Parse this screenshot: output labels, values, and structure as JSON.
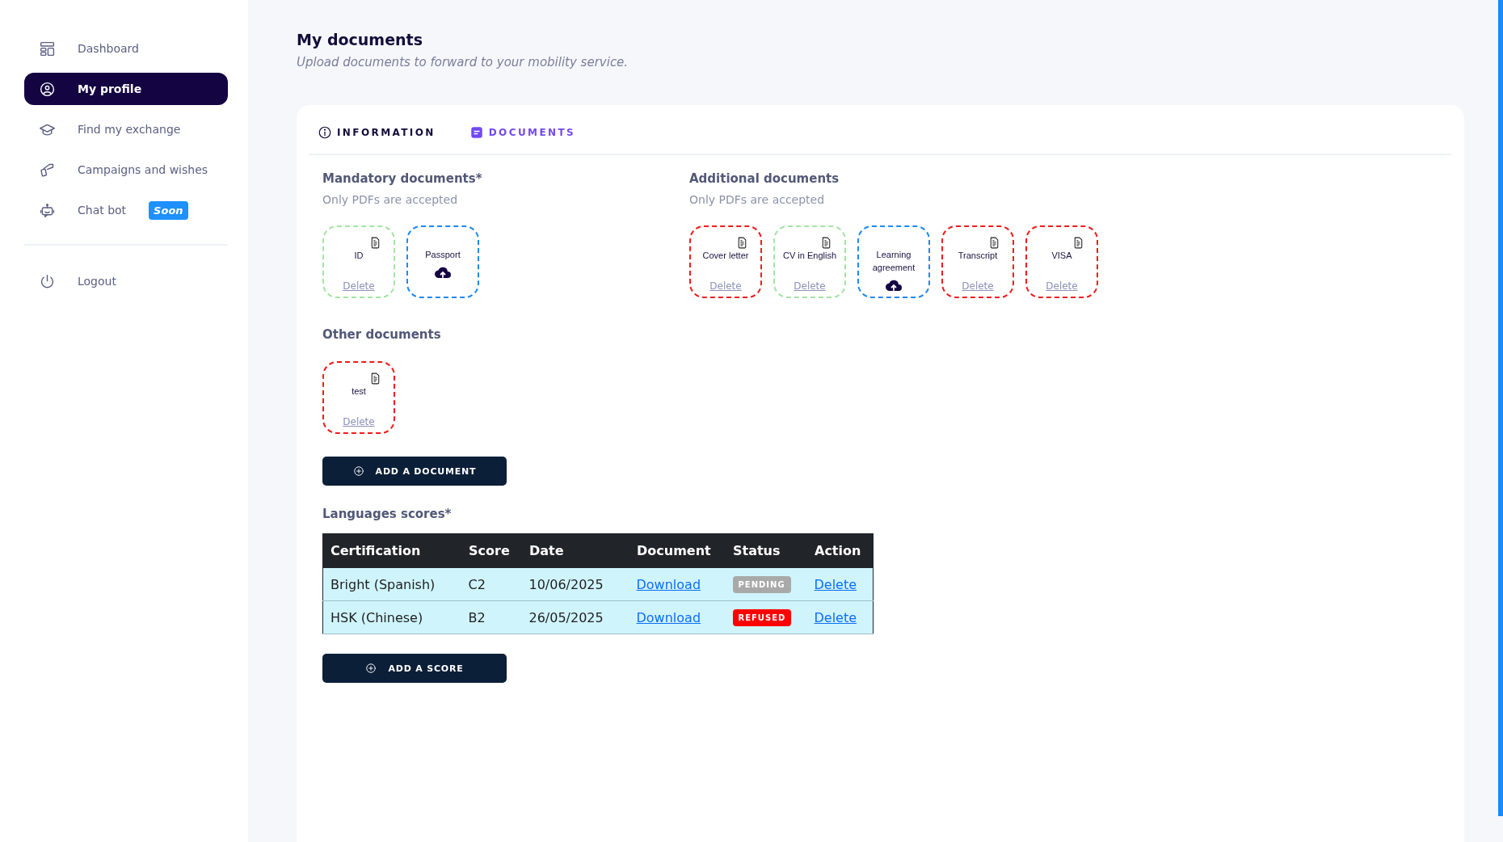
{
  "sidebar": {
    "items": [
      {
        "label": "Dashboard",
        "selected": false
      },
      {
        "label": "My profile",
        "selected": true
      },
      {
        "label": "Find my exchange",
        "selected": false
      },
      {
        "label": "Campaigns and wishes",
        "selected": false
      },
      {
        "label": "Chat bot",
        "selected": false,
        "badge": "Soon"
      }
    ],
    "footer_items": [
      {
        "label": "Logout",
        "selected": false
      }
    ]
  },
  "page": {
    "title": "My documents",
    "subtitle": "Upload documents to forward to your mobility service."
  },
  "tabs": [
    {
      "label": "INFORMATION",
      "selected": false
    },
    {
      "label": "DOCUMENTS",
      "selected": true
    }
  ],
  "groups": [
    {
      "title": "Mandatory documents*",
      "note": "Only PDFs are accepted",
      "documents": [
        {
          "name": "ID",
          "kind": "file",
          "color": "#a3e4a3",
          "action": "Delete"
        },
        {
          "name": "Passport",
          "kind": "upload",
          "color": "#1e88f5"
        }
      ]
    },
    {
      "title": "Additional documents",
      "note": "Only PDFs are accepted",
      "documents": [
        {
          "name": "Cover letter",
          "kind": "file",
          "color": "#f01b1b",
          "action": "Delete"
        },
        {
          "name": "CV in English",
          "kind": "file",
          "color": "#a3e4a3",
          "action": "Delete"
        },
        {
          "name": "Learning agreement",
          "kind": "upload",
          "color": "#1e88f5"
        },
        {
          "name": "Transcript",
          "kind": "file",
          "color": "#f01b1b",
          "action": "Delete"
        },
        {
          "name": "VISA",
          "kind": "file",
          "color": "#f01b1b",
          "action": "Delete"
        }
      ]
    }
  ],
  "other": {
    "title": "Other documents",
    "documents": [
      {
        "name": "test",
        "kind": "file",
        "color": "#f01b1b",
        "action": "Delete"
      }
    ],
    "button": "ADD A DOCUMENT"
  },
  "scores": {
    "title": "Languages scores*",
    "columns": [
      "Certification",
      "Score",
      "Date",
      "Document",
      "Status",
      "Action"
    ],
    "rows": [
      {
        "certification": "Bright (Spanish)",
        "score": "C2",
        "date": "10/06/2025",
        "document": "Download",
        "status": {
          "text": "PENDING",
          "color": "#a9a9a9"
        },
        "action": "Delete"
      },
      {
        "certification": "HSK (Chinese)",
        "score": "B2",
        "date": "26/05/2025",
        "document": "Download",
        "status": {
          "text": "REFUSED",
          "color": "#ff0000"
        },
        "action": "Delete"
      }
    ],
    "button": "ADD A SCORE"
  }
}
